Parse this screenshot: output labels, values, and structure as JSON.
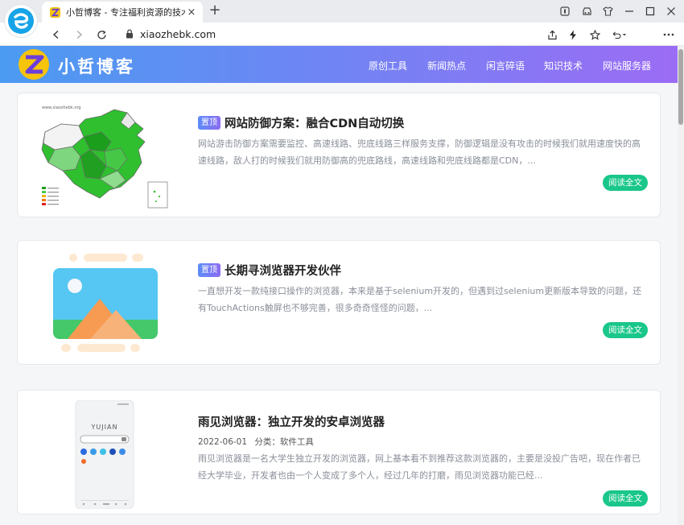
{
  "browser": {
    "tab_title": "小哲博客 - 专注福利资源的技术博",
    "new_tab_symbol": "+",
    "close_symbol": "×",
    "url": "xiaozhebk.com"
  },
  "site": {
    "name": "小哲博客",
    "nav": [
      "原创工具",
      "新闻热点",
      "闲言碎语",
      "知识技术",
      "网站服务器"
    ]
  },
  "posts": [
    {
      "badge": "置顶",
      "title": "网站防御方案：融合CDN自动切换",
      "excerpt": "网站游击防御方案需要监控、高速线路、兜底线路三样服务支撑，防御逻辑是没有攻击的时候我们就用速度快的高速线路，敌人打的时候我们就用防御高的兜底路线，高速线路和兜底线路都是CDN，...",
      "read_label": "阅读全文",
      "thumb_icon": "china-map-thumbnail"
    },
    {
      "badge": "置顶",
      "title": "长期寻浏览器开发伙伴",
      "excerpt": "一直想开发一款纯接口操作的浏览器，本来是基于selenium开发的，但遇到过selenium更新版本导致的问题，还有TouchActions触屏也不够完善，很多奇奇怪怪的问题，...",
      "read_label": "阅读全文",
      "thumb_icon": "placeholder-image-icon"
    },
    {
      "title": "雨见浏览器：独立开发的安卓浏览器",
      "date": "2022-06-01",
      "category": "分类：软件工具",
      "excerpt": "雨见浏览器是一名大学生独立开发的浏览器，网上基本看不到推荐这款浏览器的，主要是没投广告吧，现在作者已经大学毕业，开发者也由一个人变成了多个人，经过几年的打磨，雨见浏览器功能已经...",
      "read_label": "阅读全文",
      "thumb_brand": "YUJIAN"
    }
  ],
  "map_thumb_caption": "www.xiaozhebk.org",
  "colors": {
    "header_start": "#4b9bf2",
    "header_end": "#9b6cf4",
    "read_button": "#19c78a",
    "badge": "#6f7cf4"
  }
}
